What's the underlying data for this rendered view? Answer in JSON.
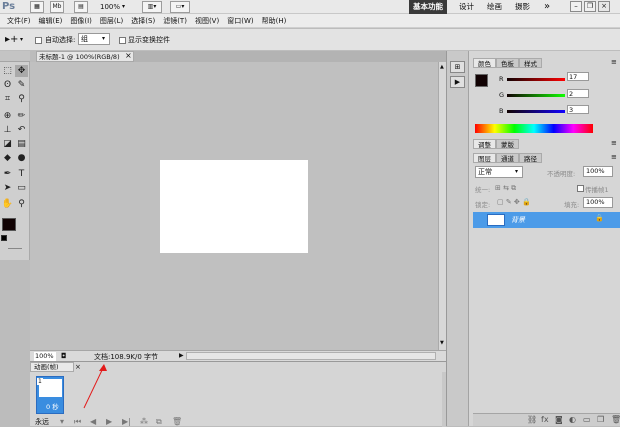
{
  "app": {
    "logo": "Ps",
    "mb": "Mb",
    "zoom": "100%"
  },
  "workspace": {
    "items": [
      "基本功能",
      "设计",
      "绘画",
      "摄影"
    ],
    "more": "»"
  },
  "menu": [
    "文件(F)",
    "编辑(E)",
    "图像(I)",
    "图层(L)",
    "选择(S)",
    "滤镜(T)",
    "视图(V)",
    "窗口(W)",
    "帮助(H)"
  ],
  "options": {
    "auto_select_label": "自动选择:",
    "auto_select_value": "组",
    "transform_label": "显示变换控件"
  },
  "document": {
    "tab_label": "未标题-1 @ 100%(RGB/8)",
    "close": "×"
  },
  "status": {
    "zoom": "100%",
    "doc_info": "文档:108.9K/0 字节"
  },
  "animation": {
    "tab_label": "动画(帧)",
    "frame_number": "1",
    "frame_delay": "0 秒",
    "loop": "永远"
  },
  "color_panel": {
    "tabs": [
      "颜色",
      "色板",
      "样式"
    ],
    "r_label": "R",
    "r_value": "17",
    "g_label": "G",
    "g_value": "2",
    "b_label": "B",
    "b_value": "3",
    "colors": {
      "foreground": "#110203",
      "r": "#c0392b",
      "g": "#2ecc40",
      "b": "#2c3ea8"
    }
  },
  "adjust_panel": {
    "tabs": [
      "调整",
      "蒙版"
    ]
  },
  "layers_panel": {
    "tabs": [
      "图层",
      "通道",
      "路径"
    ],
    "blend_mode": "正常",
    "opacity_label": "不透明度:",
    "opacity_value": "100%",
    "unify_label": "统一:",
    "propagate_label": "传播帧1",
    "lock_label": "锁定:",
    "fill_label": "填充:",
    "fill_value": "100%",
    "layer_name": "背景",
    "accent": "#4c9be8"
  }
}
